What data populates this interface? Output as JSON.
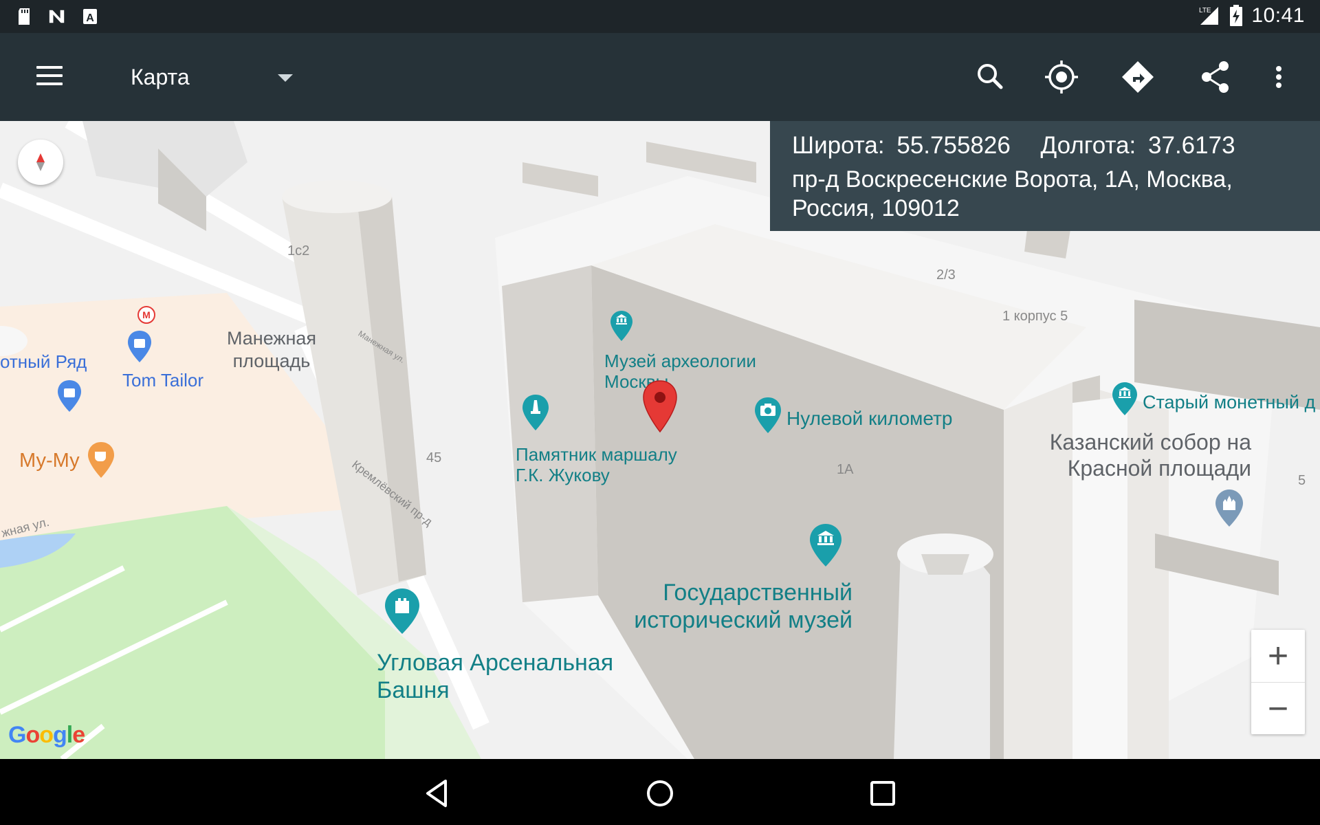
{
  "status_bar": {
    "time": "10:41",
    "network": "LTE",
    "left_icons": [
      "sd-card-icon",
      "n-icon",
      "a-icon"
    ]
  },
  "toolbar": {
    "spinner_label": "Карта",
    "icons": [
      "menu-icon",
      "search-icon",
      "my-location-icon",
      "directions-icon",
      "share-icon",
      "more-vert-icon"
    ]
  },
  "info_panel": {
    "lat_label": "Широта:",
    "lat_value": "55.755826",
    "lon_label": "Долгота:",
    "lon_value": "37.6173",
    "address": "пр-д Воскресенские Ворота, 1А, Москва, Россия, 109012"
  },
  "map": {
    "labels": {
      "manezh_square": "Манежная площадь",
      "tom_tailor": "Tom Tailor",
      "okhotny_ryad": "отный Ряд",
      "my_my": "Му-Му",
      "archaeology_museum": "Музей археологии Москвы",
      "zhukov_monument": "Памятник маршалу Г.К. Жукову",
      "zero_km": "Нулевой километр",
      "old_mint": "Старый монетный д",
      "kazan_cathedral": "Казанский собор на Красной площади",
      "historical_museum": "Государственный исторический музей",
      "arsenal_tower": "Угловая Арсенальная Башня",
      "kremlin_passage": "Кремлёвский пр-д",
      "manezh_street": "Манежная ул.",
      "street_fragment": "жная ул."
    },
    "building_numbers": [
      "1с2",
      "2/3",
      "1 корпус 5",
      "45",
      "1А",
      "5"
    ],
    "metro_letter": "M",
    "zoom_in": "+",
    "zoom_out": "−",
    "logo": "Google"
  },
  "colors": {
    "toolbar": "#263238",
    "status_bar": "#1e2529",
    "info_panel": "#37474f",
    "teal_poi": "#1a9fab",
    "marker_red": "#e53935"
  }
}
